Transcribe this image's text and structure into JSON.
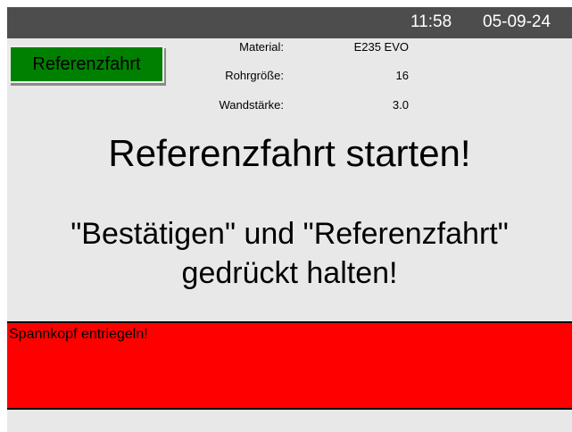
{
  "header": {
    "time": "11:58",
    "date": "05-09-24"
  },
  "reference_button_label": "Referenzfahrt",
  "info": {
    "material_label": "Material:",
    "material_value": "E235 EVO",
    "pipe_size_label": "Rohrgröße:",
    "pipe_size_value": "16",
    "wall_thickness_label": "Wandstärke:",
    "wall_thickness_value": "3.0"
  },
  "headline": "Referenzfahrt starten!",
  "instruction": {
    "line1": "\"Bestätigen\" und \"Referenzfahrt\"",
    "line2": "gedrückt halten!"
  },
  "alarm": {
    "message": "Spannkopf entriegeln!"
  },
  "colors": {
    "topbar": "#4d4d4d",
    "background": "#e8e8e8",
    "button_green": "#008000",
    "alarm_red": "#ff0000"
  }
}
